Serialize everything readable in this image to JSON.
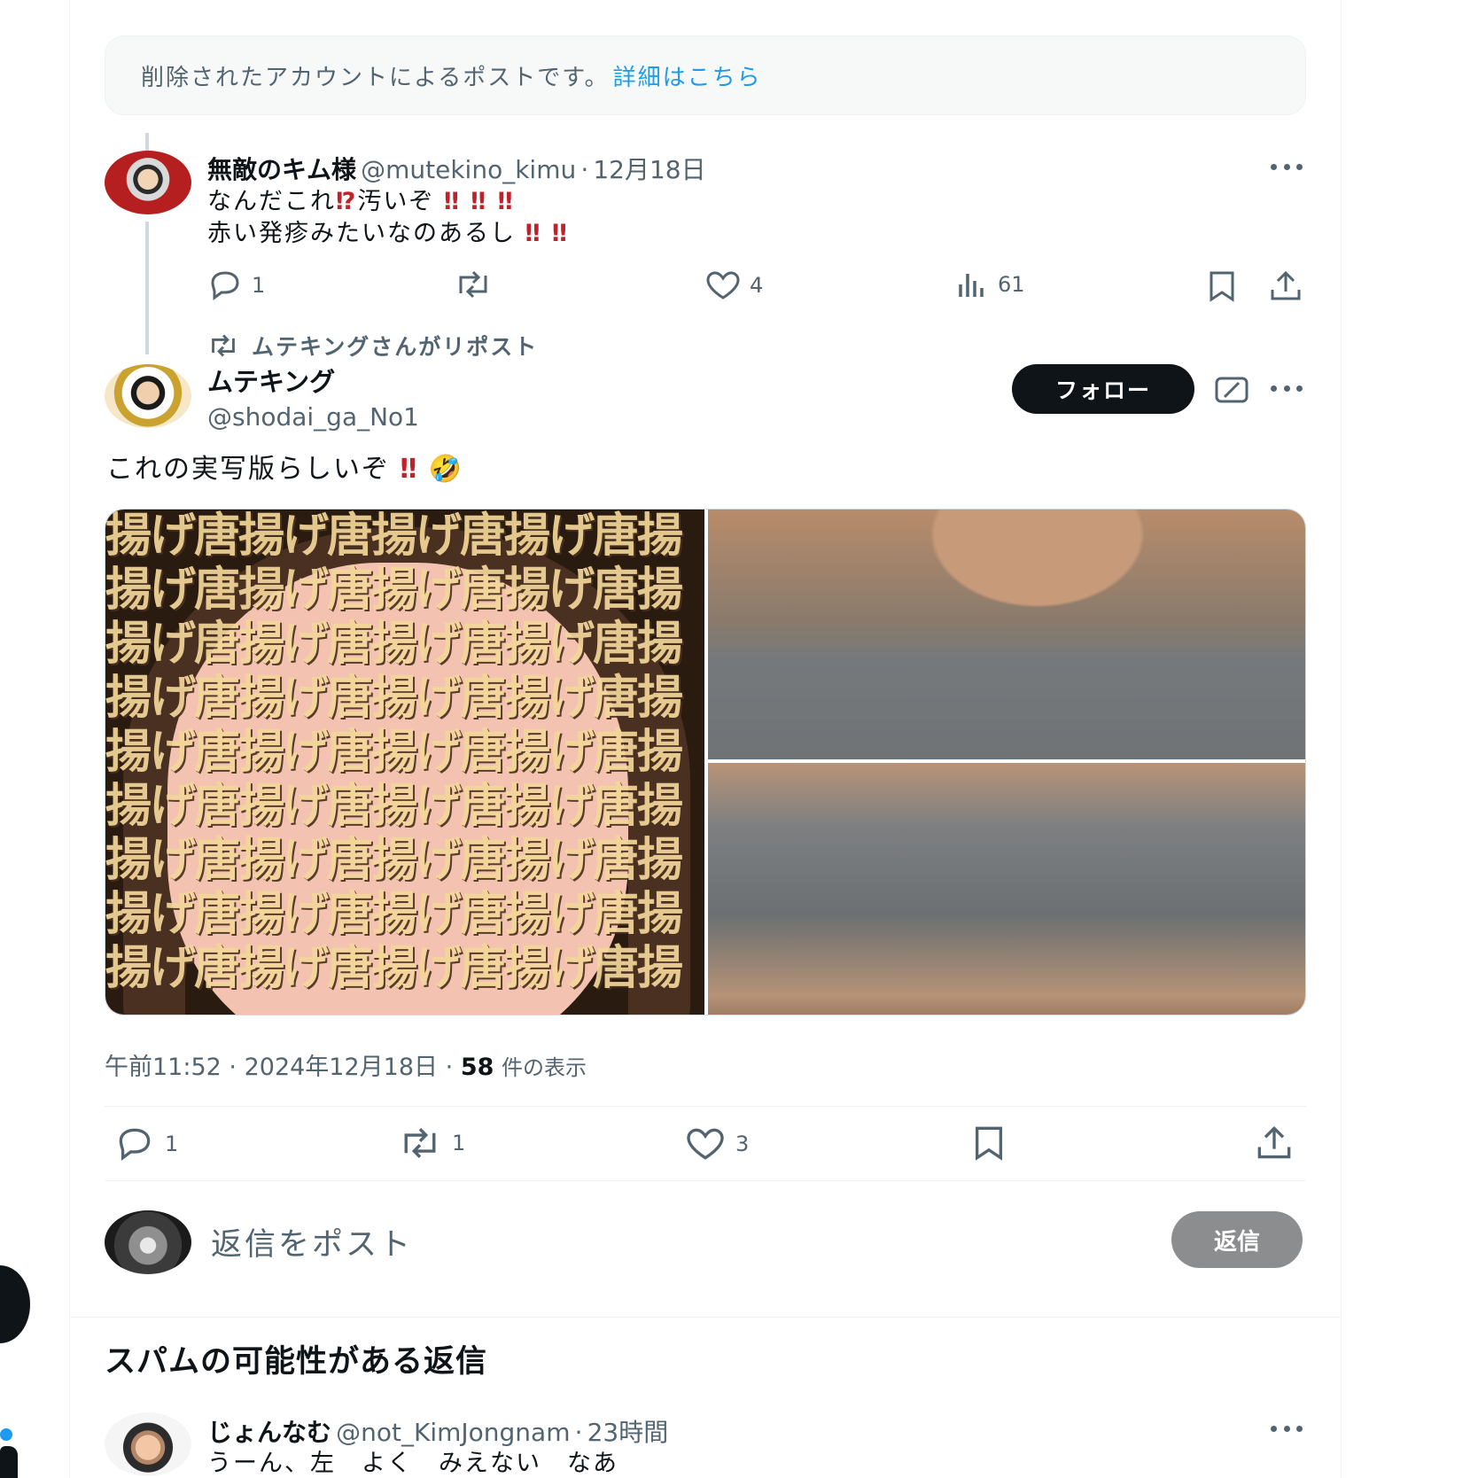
{
  "deleted_notice": {
    "text": "削除されたアカウントによるポストです。",
    "link": "詳細はこちら"
  },
  "tweet1": {
    "name": "無敵のキム様",
    "handle": "@mutekino_kimu",
    "sep": "·",
    "date": "12月18日",
    "line1_a": "なんだこれ",
    "line1_b": "⁉",
    "line1_c": "汚いぞ",
    "line1_d": "‼ ‼ ‼",
    "line2_a": "赤い発疹みたいなのあるし",
    "line2_b": "‼ ‼",
    "reply_count": "1",
    "like_count": "4",
    "view_count": "61"
  },
  "repost_label": "ムテキングさんがリポスト",
  "tweet2": {
    "name": "ムテキング",
    "handle": "@shodai_ga_No1",
    "follow_label": "フォロー",
    "text": "これの実写版らしいぞ",
    "excl": "‼",
    "emoji": "🤣",
    "image_text": "揚げ唐揚げ唐揚げ唐揚げ唐揚",
    "time": "午前11:52",
    "date": "2024年12月18日",
    "views_count": "58",
    "views_label": "件の表示",
    "reply_count": "1",
    "retweet_count": "1",
    "like_count": "3"
  },
  "compose": {
    "placeholder": "返信をポスト",
    "reply_button": "返信"
  },
  "spam_section": {
    "title": "スパムの可能性がある返信"
  },
  "tweet3": {
    "name": "じょんなむ",
    "handle": "@not_KimJongnam",
    "date": "23時間",
    "text": "うーん、左　よく　みえない　なあ"
  }
}
